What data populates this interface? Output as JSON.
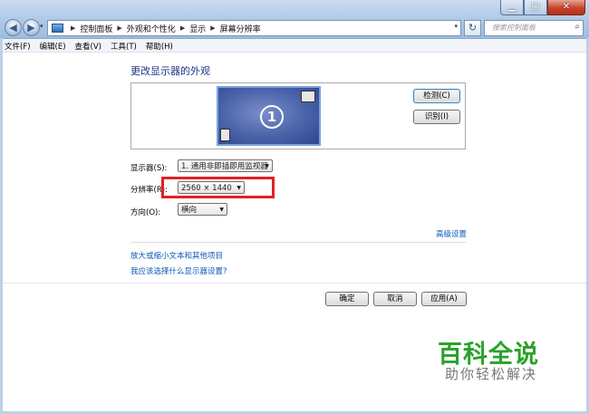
{
  "window": {
    "min_symbol": "▁",
    "max_symbol": "□",
    "close_symbol": "✕"
  },
  "nav": {
    "back_symbol": "◀",
    "forward_symbol": "▶",
    "dropdown_symbol": "▾",
    "refresh_symbol": "↻"
  },
  "breadcrumbs": [
    "控制面板",
    "外观和个性化",
    "显示",
    "屏幕分辨率"
  ],
  "search": {
    "placeholder": "搜索控制面板"
  },
  "menubar": [
    "文件(F)",
    "编辑(E)",
    "查看(V)",
    "工具(T)",
    "帮助(H)"
  ],
  "page": {
    "title": "更改显示器的外观",
    "monitor_number": "1",
    "detect_button": "检测(C)",
    "identify_button": "识别(I)"
  },
  "fields": {
    "display_label": "显示器(S):",
    "display_value": "1. 通用非即插即用监视器",
    "resolution_label": "分辨率(R):",
    "resolution_value": "2560 × 1440",
    "orientation_label": "方向(O):",
    "orientation_value": "横向"
  },
  "links": {
    "advanced": "高级设置",
    "text_size": "放大或缩小文本和其他项目",
    "which_settings": "我应该选择什么显示器设置?"
  },
  "footer": {
    "ok": "确定",
    "cancel": "取消",
    "apply": "应用(A)"
  },
  "watermark": {
    "line1": "百科全说",
    "line2": "助你轻松解决"
  },
  "colors": {
    "highlight_box": "#e22121",
    "link": "#0a5ab5",
    "title": "#1e3287",
    "watermark": "#2aa12a"
  }
}
